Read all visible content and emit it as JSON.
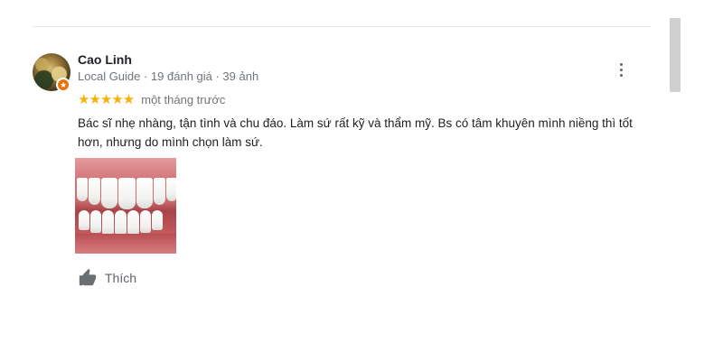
{
  "review": {
    "author_name": "Cao Linh",
    "author_meta": "Local Guide · 19 đánh giá · 39 ảnh",
    "rating": 5,
    "stars_text": "★★★★★",
    "date": "một tháng trước",
    "text": "Bác sĩ nhẹ nhàng, tận tình và chu đáo. Làm sứ rất kỹ và thẩm mỹ. Bs có tâm khuyên mình niềng thì tốt hơn, nhưng do mình chọn làm sứ.",
    "like_label": "Thích"
  },
  "icons": {
    "more": "more-vert-icon",
    "like": "thumbs-up-icon",
    "badge": "local-guide-star-icon"
  },
  "colors": {
    "star": "#f6b20a",
    "badge": "#e8710a",
    "meta_text": "#70757a"
  }
}
